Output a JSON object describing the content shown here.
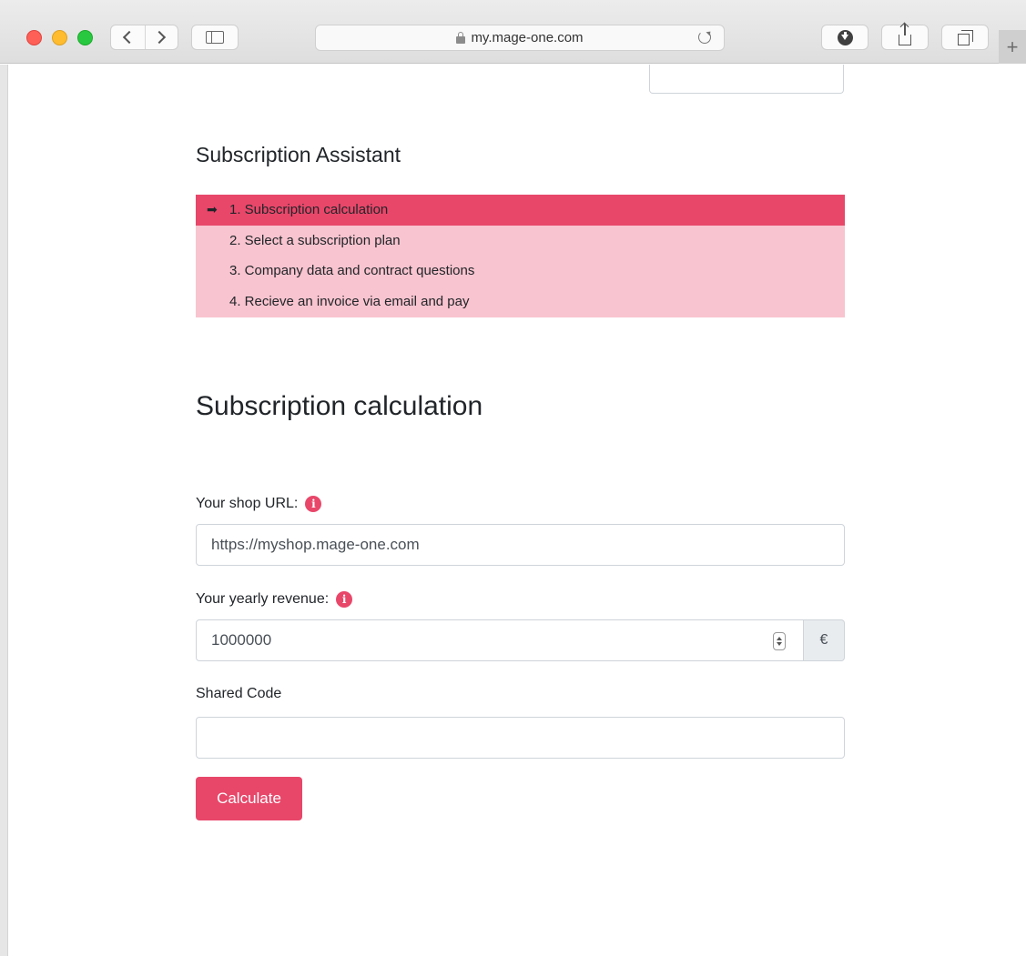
{
  "browser": {
    "url": "my.mage-one.com",
    "icons": {
      "back": "chevron-left-icon",
      "forward": "chevron-right-icon",
      "sidebar": "sidebar-icon",
      "lock": "lock-icon",
      "reload": "reload-icon",
      "download": "download-icon",
      "share": "share-icon",
      "tabs": "tabs-icon",
      "new_tab": "plus-icon"
    },
    "new_tab_label": "+"
  },
  "assistant": {
    "title": "Subscription Assistant",
    "arrow": "➡",
    "steps": [
      {
        "label": "1. Subscription calculation",
        "active": true
      },
      {
        "label": "2. Select a subscription plan",
        "active": false
      },
      {
        "label": "3. Company data and contract questions",
        "active": false
      },
      {
        "label": "4. Recieve an invoice via email and pay",
        "active": false
      }
    ]
  },
  "form": {
    "title": "Subscription calculation",
    "shop_url": {
      "label": "Your shop URL:",
      "value": "https://myshop.mage-one.com"
    },
    "revenue": {
      "label": "Your yearly revenue:",
      "value": "1000000",
      "currency": "€"
    },
    "shared_code": {
      "label": "Shared Code",
      "value": ""
    },
    "info_glyph": "i",
    "submit_label": "Calculate"
  },
  "colors": {
    "accent": "#e8476a",
    "steps_background": "#f8c4cf"
  }
}
